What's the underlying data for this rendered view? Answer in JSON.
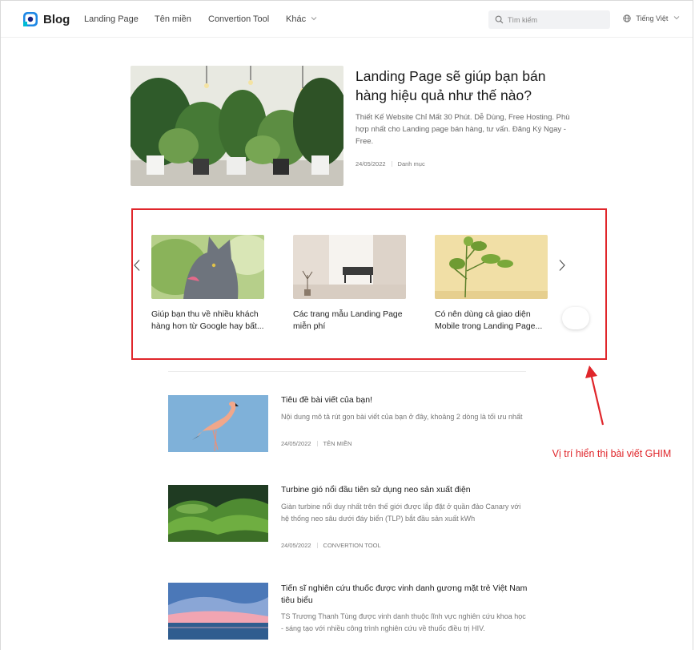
{
  "nav": {
    "logo_text": "Blog",
    "menu": [
      "Landing Page",
      "Tên miền",
      "Convertion Tool",
      "Khác"
    ],
    "search_placeholder": "Tìm kiếm",
    "language": "Tiếng Việt"
  },
  "hero": {
    "title": "Landing Page sẽ giúp bạn bán hàng hiệu quả như thế nào?",
    "description": "Thiết Kế Website Chỉ Mất 30 Phút. Dễ Dùng, Free Hosting. Phù hợp nhất cho Landing page bán hàng, tư vấn. Đăng Ký Ngay - Free.",
    "date": "24/05/2022",
    "category": "Danh mục"
  },
  "pinned": {
    "cards": [
      {
        "title": "Giúp bạn thu về nhiều khách hàng hơn từ Google hay bất..."
      },
      {
        "title": "Các trang mẫu Landing Page miễn phí"
      },
      {
        "title": "Có nên dùng cả giao diện Mobile trong Landing Page..."
      }
    ]
  },
  "posts": [
    {
      "title": "Tiêu đề bài viết của bạn!",
      "description": "Nội dung mô tả rút gọn bài viết của bạn ở đây, khoảng 2 dòng là tối ưu nhất",
      "date": "24/05/2022",
      "category": "TÊN MIỀN"
    },
    {
      "title": "Turbine gió nổi đầu tiên sử dụng neo sản xuất điện",
      "description": "Giàn turbine nổi duy nhất trên thế giới được lắp đặt ở quần đảo Canary với hệ thống neo sâu dưới đáy biển (TLP) bắt đầu sản xuất kWh",
      "date": "24/05/2022",
      "category": "CONVERTION TOOL"
    },
    {
      "title": "Tiến sĩ nghiên cứu thuốc được vinh danh gương mặt trẻ Việt Nam tiêu biểu",
      "description": "TS Trương Thanh Tùng được vinh danh thuộc lĩnh vực nghiên cứu khoa học - sáng tạo với nhiều công trình nghiên cứu về thuốc điều trị HIV."
    }
  ],
  "annotation": {
    "text": "Vị trí hiển thị bài viết GHIM",
    "color": "#e0262b"
  }
}
